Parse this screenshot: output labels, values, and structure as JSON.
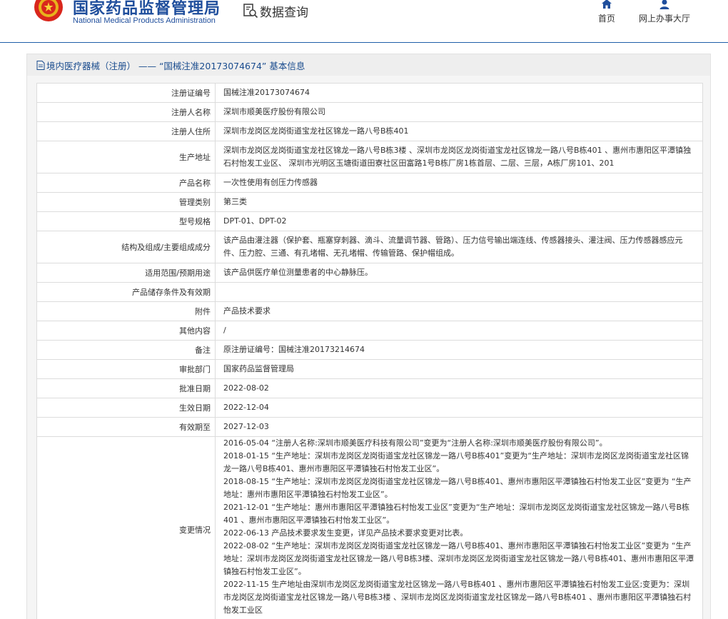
{
  "header": {
    "brand_cn": "国家药品监督管理局",
    "brand_en": "National Medical Products Administration",
    "query_label": "数据查询",
    "nav": {
      "home": "首页",
      "online_hall": "网上办事大厅"
    },
    "colors": {
      "brand": "#1f4e9c",
      "title": "#1a4c8e"
    }
  },
  "panel": {
    "title": "境内医疗器械（注册） —— “国械注准20173074674” 基本信息",
    "rows": [
      {
        "label": "注册证编号",
        "value": "国械注准20173074674"
      },
      {
        "label": "注册人名称",
        "value": "深圳市顺美医疗股份有限公司"
      },
      {
        "label": "注册人住所",
        "value": "深圳市龙岗区龙岗街道宝龙社区锦龙一路八号B栋401"
      },
      {
        "label": "生产地址",
        "value": "深圳市龙岗区龙岗街道宝龙社区锦龙一路八号B栋3楼 、深圳市龙岗区龙岗街道宝龙社区锦龙一路八号B栋401 、惠州市惠阳区平潭镇独石村怡发工业区、 深圳市光明区玉塘街道田寮社区田富路1号B栋厂房1栋首层、二层、三层，A栋厂房101、201"
      },
      {
        "label": "产品名称",
        "value": "一次性使用有创压力传感器"
      },
      {
        "label": "管理类别",
        "value": "第三类"
      },
      {
        "label": "型号规格",
        "value": "DPT-01、DPT-02"
      },
      {
        "label": "结构及组成/主要组成成分",
        "value": "该产品由灌注器（保护套、瓶塞穿刺器、滴斗、流量调节器、管路）、压力信号输出端连线、传感器接头、灌注阀、压力传感器感应元件、压力腔、三通、有孔堵帽、无孔堵帽、传输管路、保护帽组成。"
      },
      {
        "label": "适用范围/预期用途",
        "value": "该产品供医疗单位测量患者的中心静脉压。"
      },
      {
        "label": "产品储存条件及有效期",
        "value": ""
      },
      {
        "label": "附件",
        "value": "产品技术要求"
      },
      {
        "label": "其他内容",
        "value": "/"
      },
      {
        "label": "备注",
        "value": "原注册证编号：国械注准20173214674"
      },
      {
        "label": "审批部门",
        "value": "国家药品监督管理局"
      },
      {
        "label": "批准日期",
        "value": "2022-08-02"
      },
      {
        "label": "生效日期",
        "value": "2022-12-04"
      },
      {
        "label": "有效期至",
        "value": "2027-12-03"
      }
    ],
    "changes_label": "变更情况",
    "changes": [
      "2016-05-04 “注册人名称:深圳市顺美医疗科技有限公司”变更为“注册人名称:深圳市顺美医疗股份有限公司”。",
      "2018-01-15 “生产地址：深圳市龙岗区龙岗街道宝龙社区锦龙一路八号B栋401”变更为“生产地址：深圳市龙岗区龙岗街道宝龙社区锦龙一路八号B栋401、惠州市惠阳区平潭镇独石村怡发工业区”。",
      "2018-08-15 “生产地址：深圳市龙岗区龙岗街道宝龙社区锦龙一路八号B栋401、惠州市惠阳区平潭镇独石村怡发工业区”变更为 “生产地址：惠州市惠阳区平潭镇独石村怡发工业区”。",
      "2021-12-01 “生产地址：惠州市惠阳区平潭镇独石村怡发工业区”变更为“生产地址：深圳市龙岗区龙岗街道宝龙社区锦龙一路八号B栋401 、惠州市惠阳区平潭镇独石村怡发工业区”。",
      "2022-06-13 产品技术要求发生变更，详见产品技术要求变更对比表。",
      "2022-08-02 “生产地址：深圳市龙岗区龙岗街道宝龙社区锦龙一路八号B栋401、惠州市惠阳区平潭镇独石村怡发工业区”变更为 “生产地址：深圳市龙岗区龙岗街道宝龙社区锦龙一路八号B栋3楼、深圳市龙岗区龙岗街道宝龙社区锦龙一路八号B栋401、惠州市惠阳区平潭镇独石村怡发工业区”。",
      "2022-11-15 生产地址由深圳市龙岗区龙岗街道宝龙社区锦龙一路八号B栋401 、惠州市惠阳区平潭镇独石村怡发工业区;变更为：深圳市龙岗区龙岗街道宝龙社区锦龙一路八号B栋3楼 、深圳市龙岗区龙岗街道宝龙社区锦龙一路八号B栋401 、惠州市惠阳区平潭镇独石村怡发工业区"
    ]
  }
}
